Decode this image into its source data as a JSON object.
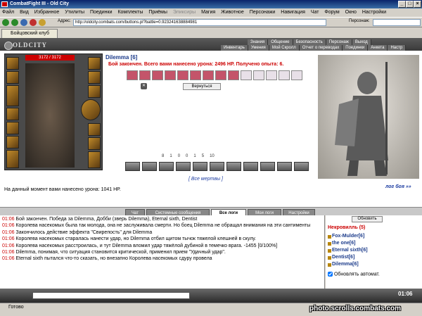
{
  "window": {
    "title": "CombatFight III - Old City"
  },
  "menu": [
    "Файл",
    "Вид",
    "Избранное",
    "Утилиты",
    "Поединки",
    "Комплекты",
    "Приёмы",
    "Эликсиры",
    "Магия",
    "Животное",
    "Персонажи",
    "Навигация",
    "Чат",
    "Форум",
    "Окно",
    "Настройки"
  ],
  "address": {
    "label": "Адрес:",
    "url": "http://oldcity.combats.com/buttons.pl?battle=0.923241638884981",
    "person_label": "Персонаж:"
  },
  "tab": {
    "label": "Бойцовский клуб"
  },
  "game": {
    "logo": "OLDCITY",
    "nav_top": [
      "Знания",
      "Общение",
      "Безопасность",
      "Персонаж",
      "Выход"
    ],
    "nav_bottom": [
      "Инвентарь",
      "Умения",
      "Мой Скролл",
      "Отчет о переводах",
      "Поединки",
      "Анкета",
      "Настр"
    ],
    "hp": "3172 / 3172"
  },
  "battle": {
    "name": "Dilemma [6]",
    "message": "Бой закончен. Всего вами нанесено урона: 2496 HP. Получено опыта: 6.",
    "return_label": "Вернуться",
    "stats": [
      "8",
      "1",
      "0",
      "0",
      "1",
      "5",
      "10"
    ],
    "all_dead": "[ Все мертвы ]",
    "log_link": "лог боя »»",
    "damage_text": "На данный момент вами нанесено урона: 1041 HP."
  },
  "chat_tabs": [
    "Чат",
    "Системные сообщения",
    "Все логи",
    "Мои логи",
    "Настройки"
  ],
  "chat": [
    {
      "time": "01:06",
      "text": "Бой закончен. Победа за Dilemma, Добби (зверь Dilemma), Eternal sixth, Dentist"
    },
    {
      "time": "01:06",
      "text": "Королева насекомых была так молода, она не заслуживала смерти. Но боец Dilemma не обращал внимания на эти сантименты"
    },
    {
      "time": "01:06",
      "text": "Закончилось действие эффекта \"Свирепость\" для Dilemma"
    },
    {
      "time": "01:06",
      "text": "Королева насекомых старалась нанести удар, но Dilemma отбил щитом тычок тяжелой клешней в скулу."
    },
    {
      "time": "01:06",
      "text": "Королева насекомых расстроилась, и тут Dilemma вломил удар тяжёлой дубиной в темечко врага. -1455 [0/100%]"
    },
    {
      "time": "01:06",
      "text": "Dilemma, понимая, что ситуация становится критической, применил прием \"Удачный удар\"."
    },
    {
      "time": "01:06",
      "text": "Eternal sixth пытался что-то сказать, но внезапно Королева насекомых сдуру провела"
    }
  ],
  "right": {
    "refresh": "Обновить",
    "location": "Некровилль (5)",
    "players": [
      "Fox-Mulder[6]",
      "the one[6]",
      "Eternal sixth[6]",
      "Dentist[6]",
      "Dilemma[6]"
    ],
    "auto": "Обновлять автомат."
  },
  "clock": "01:06",
  "status": "Готово",
  "watermark": "photo.scrolls.combats.com"
}
